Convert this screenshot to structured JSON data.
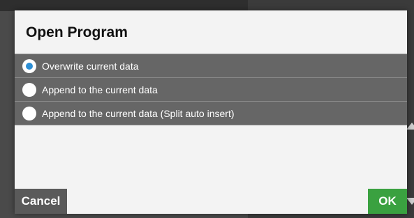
{
  "dialog": {
    "title": "Open Program",
    "options": [
      {
        "label": "Overwrite current data",
        "selected": true
      },
      {
        "label": "Append to the current data",
        "selected": false
      },
      {
        "label": "Append to the current data (Split auto insert)",
        "selected": false
      }
    ],
    "cancel_label": "Cancel",
    "ok_label": "OK"
  },
  "colors": {
    "option_background": "#666666",
    "radio_selected": "#2d8fd5",
    "ok_button": "#3aa140",
    "cancel_button": "#5a5a5a",
    "dialog_background": "#f3f3f3"
  }
}
